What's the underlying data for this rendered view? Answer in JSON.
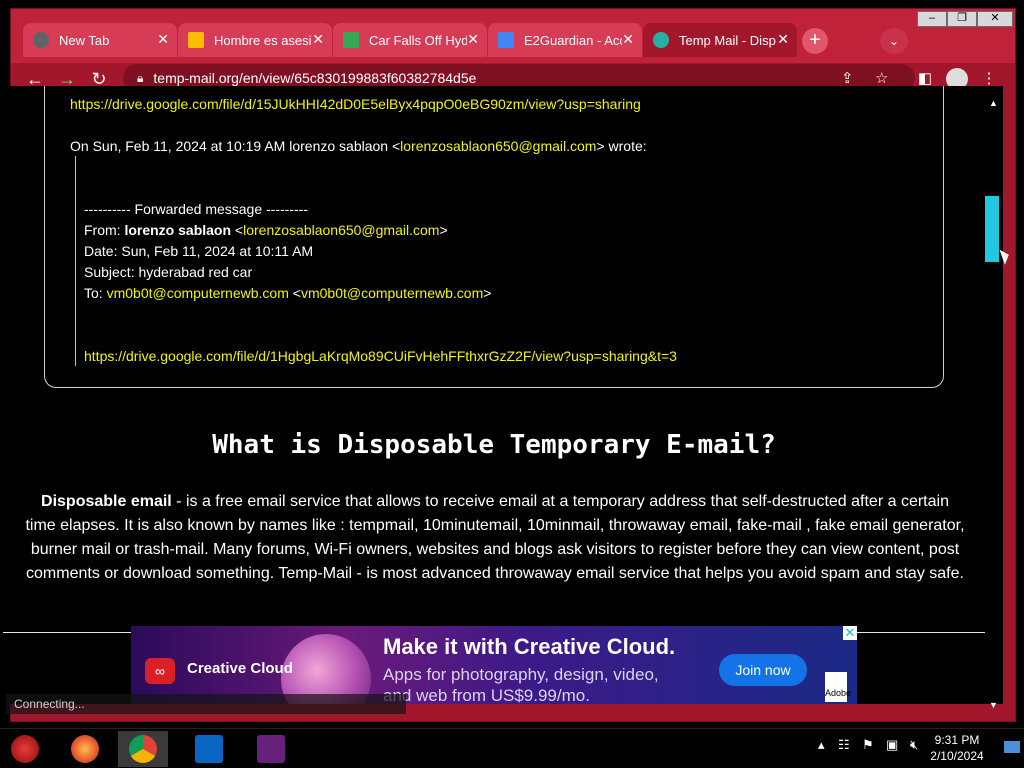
{
  "window_controls": {
    "minimize": "–",
    "restore": "❐",
    "close": "✕"
  },
  "tabs": [
    {
      "title": "New Tab",
      "color": "#444444"
    },
    {
      "title": "Hombre es asesi",
      "color": "#1a73e8"
    },
    {
      "title": "Car Falls Off Hyd",
      "color": "#1a73e8"
    },
    {
      "title": "E2Guardian - Acc",
      "color": "#1a73e8"
    },
    {
      "title": "Temp Mail - Disp",
      "color": "#23b1a5"
    }
  ],
  "tab_close": "✕",
  "new_tab": "+",
  "tab_search": "⌄",
  "nav": {
    "back": "←",
    "forward": "→",
    "reload": "↻"
  },
  "address": {
    "url": "temp-mail.org/en/view/65c830199883f60382784d5e"
  },
  "email": {
    "link1": "https://drive.google.com/file/d/15JUkHHI42dD0E5elByx4pqpO0eBG90zm/view?usp=sharing",
    "on_prefix": "On Sun, Feb 11, 2024 at 10:19 AM lorenzo sablaon <",
    "on_email": "lorenzosablaon650@gmail.com",
    "on_suffix": "> wrote:",
    "fwd_header": "---------- Forwarded message ---------",
    "from_label": "From: ",
    "from_name": "lorenzo sablaon",
    "from_lt": " <",
    "from_email": "lorenzosablaon650@gmail.com",
    "from_gt": ">",
    "date_line": "Date: Sun, Feb 11, 2024 at 10:11 AM",
    "subject_line": "Subject: hyderabad red car",
    "to_label": "To: ",
    "to_email1": "vm0b0t@computernewb.com",
    "to_lt": " <",
    "to_email2": "vm0b0t@computernewb.com",
    "to_gt": ">",
    "link2": "https://drive.google.com/file/d/1HgbgLaKrqMo89CUiFvHehFFthxrGzZ2F/view?usp=sharing&t=3"
  },
  "section": {
    "heading": "What is Disposable Temporary E-mail?",
    "bold_term": "Disposable email",
    "body": " - is a free email service that allows to receive email at a temporary address that self-destructed after a certain time elapses. It is also known by names like : tempmail, 10minutemail, 10minmail, throwaway email, fake-mail , fake email generator, burner mail or trash-mail. Many forums, Wi-Fi owners, websites and blogs ask visitors to register before they can view content, post comments or download something. Temp-Mail - is most advanced throwaway email service that helps you avoid spam and stay safe."
  },
  "ad": {
    "brand": "Creative Cloud",
    "headline": "Make it with Creative Cloud.",
    "sub": "Apps for photography, design, video, and web from US$9.99/mo.",
    "cta": "Join now",
    "adobe": "Adobe",
    "close": "✕"
  },
  "status": "Connecting...",
  "clock": {
    "time": "9:31 PM",
    "date": "2/10/2024"
  }
}
